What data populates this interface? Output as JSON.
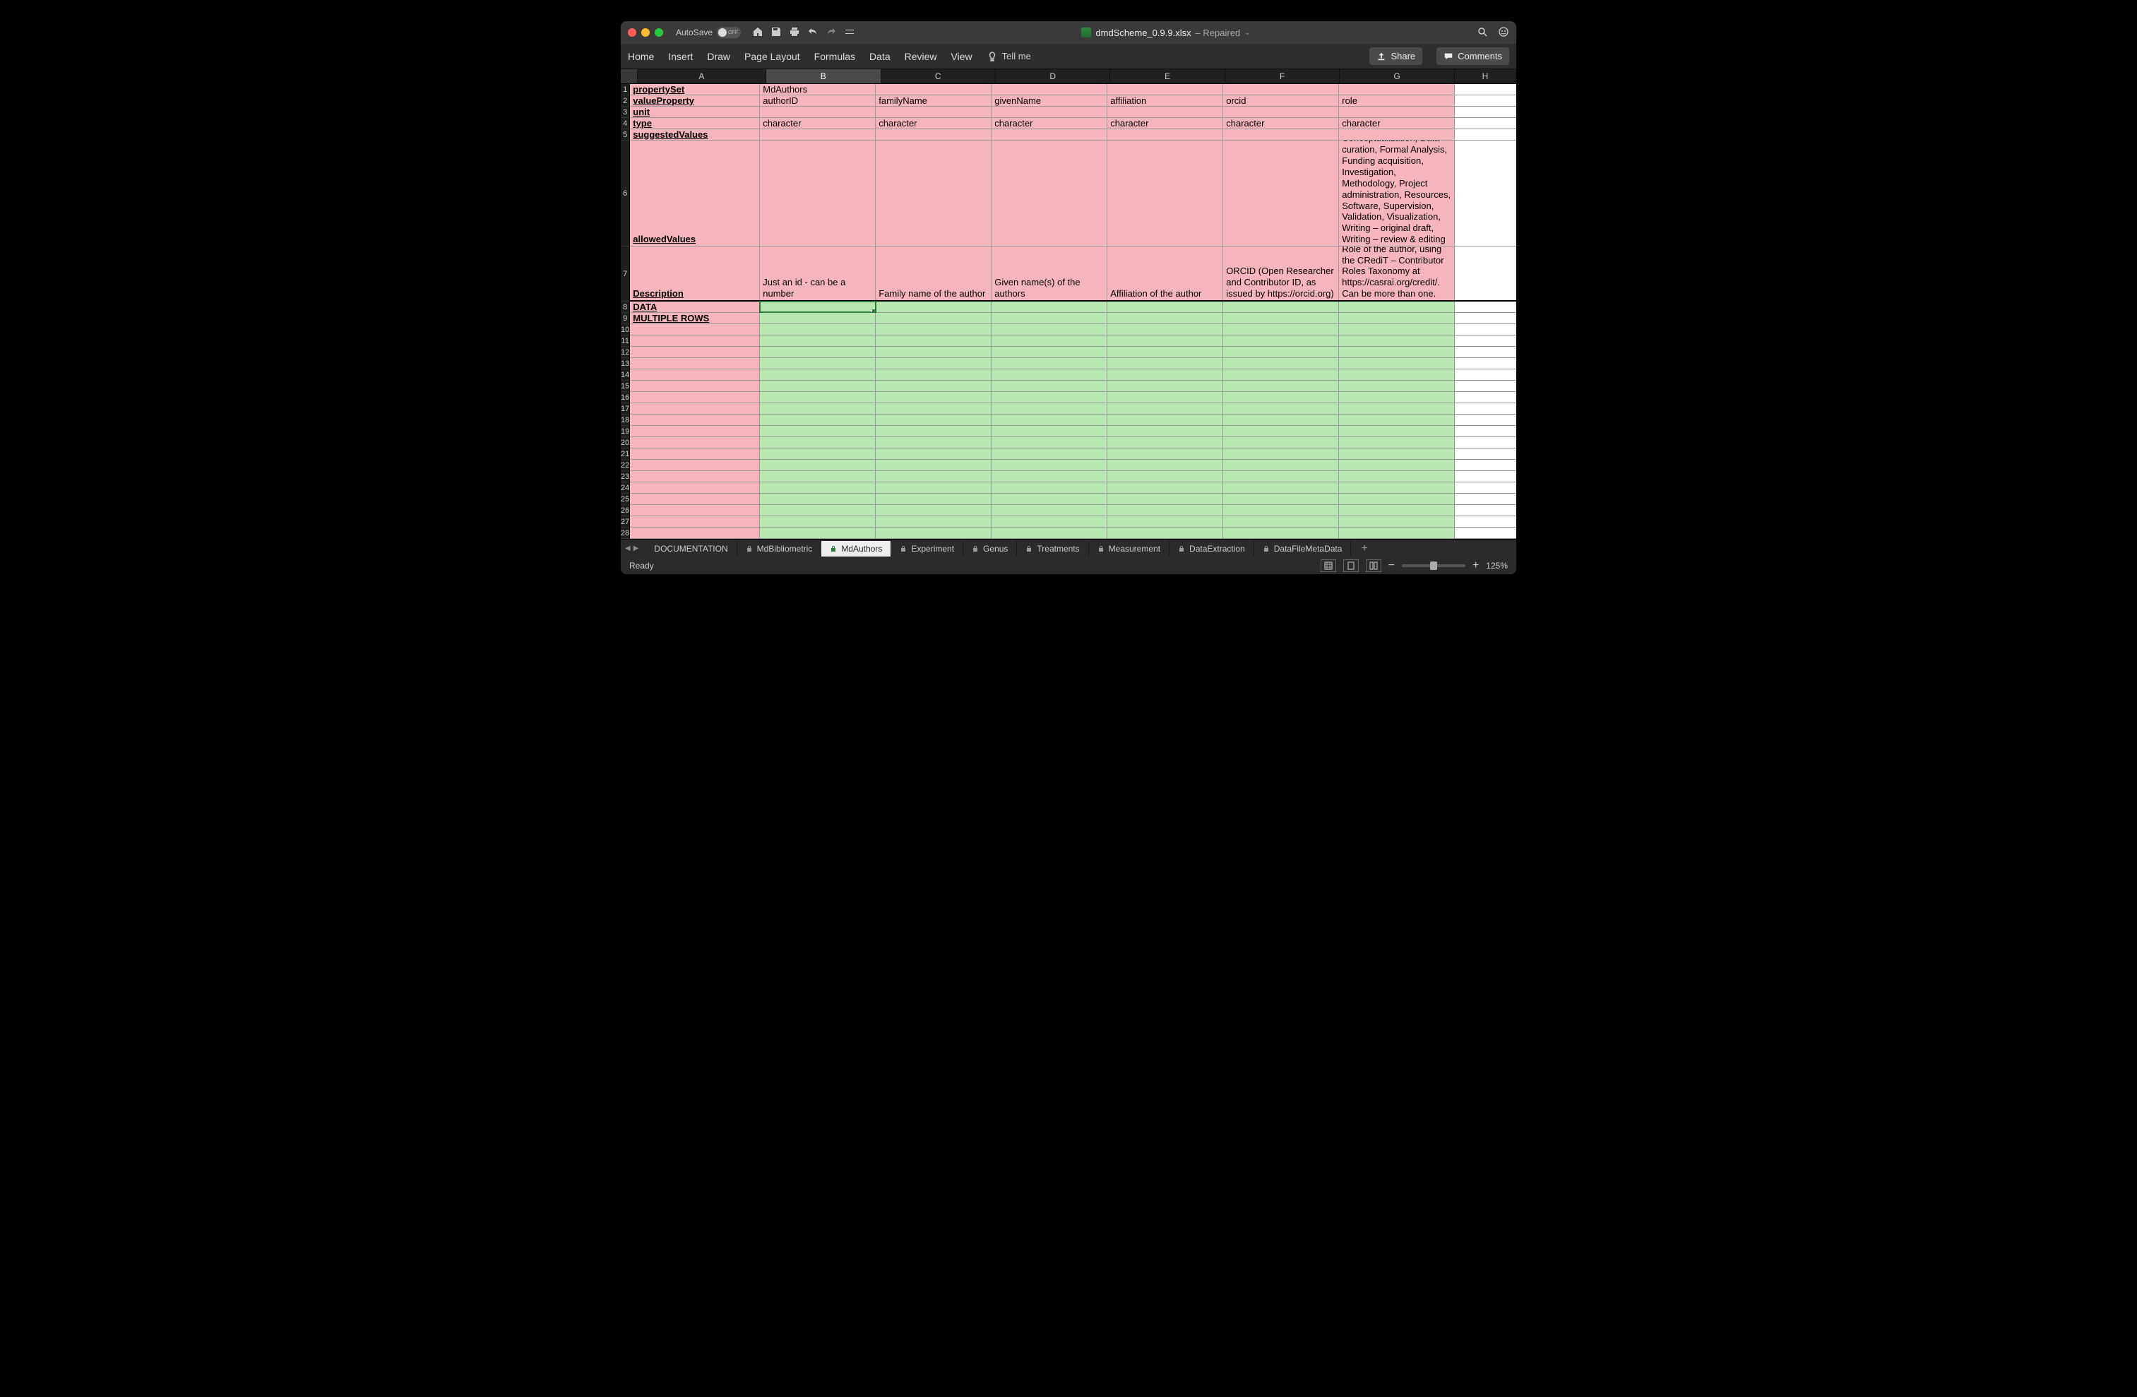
{
  "titlebar": {
    "autosave_label": "AutoSave",
    "autosave_state": "OFF",
    "filename": "dmdScheme_0.9.9.xlsx",
    "status": "Repaired"
  },
  "ribbon": {
    "tabs": [
      "Home",
      "Insert",
      "Draw",
      "Page Layout",
      "Formulas",
      "Data",
      "Review",
      "View"
    ],
    "tell_me": "Tell me",
    "share": "Share",
    "comments": "Comments"
  },
  "columns": [
    "A",
    "B",
    "C",
    "D",
    "E",
    "F",
    "G",
    "H"
  ],
  "selected_cell": "B8",
  "rows": [
    {
      "n": 1,
      "h": 16,
      "a": "propertySet",
      "abold": true,
      "b": "MdAuthors",
      "c": "",
      "d": "",
      "e": "",
      "f": "",
      "g": ""
    },
    {
      "n": 2,
      "h": 16,
      "a": "valueProperty",
      "abold": true,
      "b": "authorID",
      "c": "familyName",
      "d": "givenName",
      "e": "affiliation",
      "f": "orcid",
      "g": "role"
    },
    {
      "n": 3,
      "h": 16,
      "a": "unit",
      "abold": true,
      "b": "",
      "c": "",
      "d": "",
      "e": "",
      "f": "",
      "g": ""
    },
    {
      "n": 4,
      "h": 16,
      "a": "type",
      "abold": true,
      "b": "character",
      "c": "character",
      "d": "character",
      "e": "character",
      "f": "character",
      "g": "character"
    },
    {
      "n": 5,
      "h": 16,
      "a": "suggestedValues",
      "abold": true,
      "b": "",
      "c": "",
      "d": "",
      "e": "",
      "f": "",
      "g": ""
    },
    {
      "n": 6,
      "h": 150,
      "a": "allowedValues",
      "abold": true,
      "b": "",
      "c": "",
      "d": "",
      "e": "",
      "f": "",
      "g": "Conceptualization, Data curation, Formal Analysis, Funding acquisition, Investigation, Methodology, Project administration, Resources, Software, Supervision, Validation, Visualization, Writing – original draft, Writing – review & editing"
    },
    {
      "n": 7,
      "h": 78,
      "hb": true,
      "a": "Description",
      "abold": true,
      "b": "Just an id - can be a number",
      "c": "Family name of the author",
      "d": "Given name(s) of the authors",
      "e": "Affiliation of the author",
      "f": "ORCID (Open Researcher and Contributor ID, as issued by https://orcid.org)",
      "g": "Role of the author, using the CRediT – Contributor Roles Taxonomy at https://casrai.org/credit/. Can be more than one."
    },
    {
      "n": 8,
      "h": 16,
      "a": "DATA",
      "abold": true,
      "data": true
    },
    {
      "n": 9,
      "h": 16,
      "a": "MULTIPLE ROWS",
      "abold": true,
      "data": true
    },
    {
      "n": 10,
      "h": 16,
      "data": true
    },
    {
      "n": 11,
      "h": 16,
      "data": true
    },
    {
      "n": 12,
      "h": 16,
      "data": true
    },
    {
      "n": 13,
      "h": 16,
      "data": true
    },
    {
      "n": 14,
      "h": 16,
      "data": true
    },
    {
      "n": 15,
      "h": 16,
      "data": true
    },
    {
      "n": 16,
      "h": 16,
      "data": true
    },
    {
      "n": 17,
      "h": 16,
      "data": true
    },
    {
      "n": 18,
      "h": 16,
      "data": true
    },
    {
      "n": 19,
      "h": 16,
      "data": true
    },
    {
      "n": 20,
      "h": 16,
      "data": true
    },
    {
      "n": 21,
      "h": 16,
      "data": true
    },
    {
      "n": 22,
      "h": 16,
      "data": true
    },
    {
      "n": 23,
      "h": 16,
      "data": true
    },
    {
      "n": 24,
      "h": 16,
      "data": true
    },
    {
      "n": 25,
      "h": 16,
      "data": true
    },
    {
      "n": 26,
      "h": 16,
      "data": true
    },
    {
      "n": 27,
      "h": 16,
      "data": true
    },
    {
      "n": 28,
      "h": 16,
      "data": true
    }
  ],
  "sheet_tabs": [
    {
      "label": "DOCUMENTATION",
      "locked": false
    },
    {
      "label": "MdBibliometric",
      "locked": true
    },
    {
      "label": "MdAuthors",
      "locked": true,
      "active": true
    },
    {
      "label": "Experiment",
      "locked": true
    },
    {
      "label": "Genus",
      "locked": true
    },
    {
      "label": "Treatments",
      "locked": true
    },
    {
      "label": "Measurement",
      "locked": true
    },
    {
      "label": "DataExtraction",
      "locked": true
    },
    {
      "label": "DataFileMetaData",
      "locked": true
    }
  ],
  "statusbar": {
    "ready": "Ready",
    "zoom": "125%"
  }
}
